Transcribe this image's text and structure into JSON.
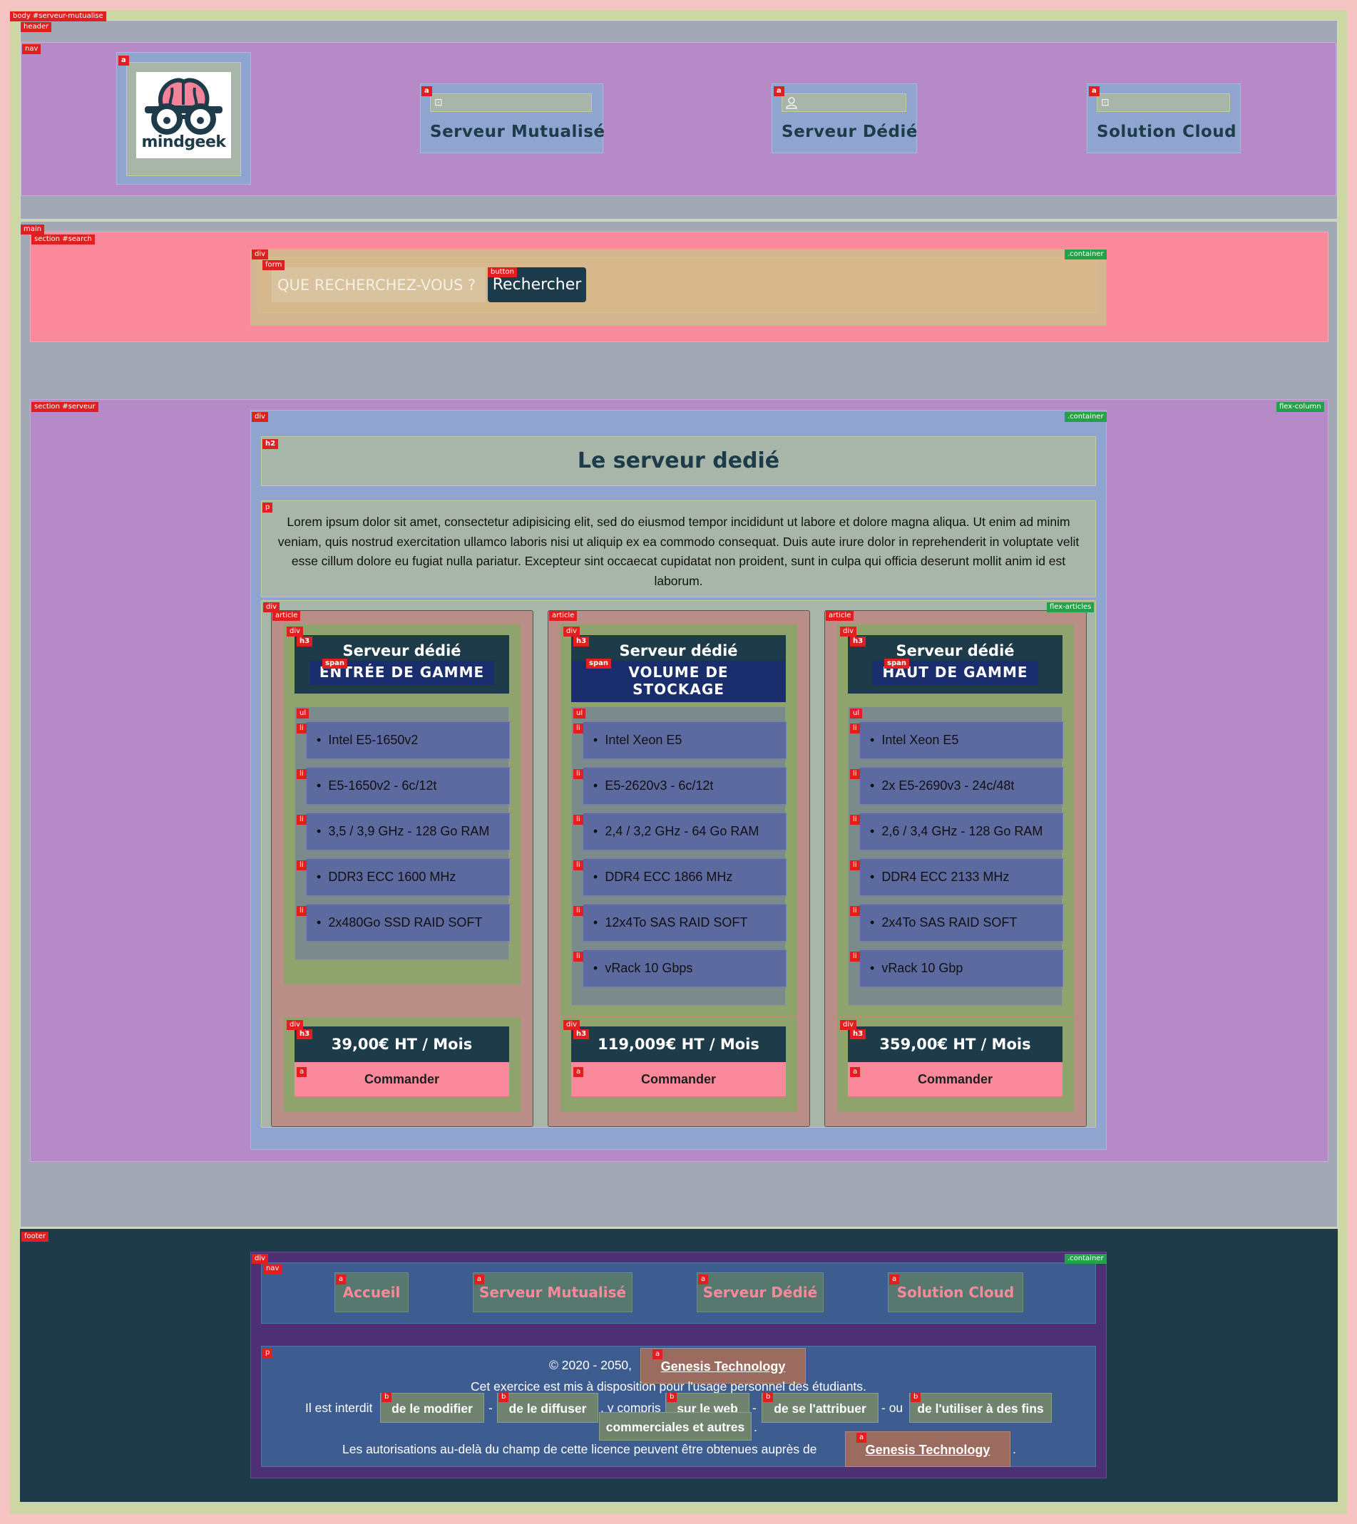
{
  "brand": {
    "logo_text": "mindgeek"
  },
  "header": {
    "nav": [
      {
        "label": "Serveur Mutualisé",
        "icon": "server-icon"
      },
      {
        "label": "Serveur Dédié",
        "icon": "user-icon"
      },
      {
        "label": "Solution Cloud",
        "icon": "cloud-icon"
      }
    ]
  },
  "search": {
    "placeholder": "QUE RECHERCHEZ-VOUS ?",
    "button_label": "Rechercher"
  },
  "serveur": {
    "title": "Le serveur dedié",
    "description": "Lorem ipsum dolor sit amet, consectetur adipisicing elit, sed do eiusmod tempor incididunt ut labore et dolore magna aliqua. Ut enim ad minim veniam, quis nostrud exercitation ullamco laboris nisi ut aliquip ex ea commodo consequat. Duis aute irure dolor in reprehenderit in voluptate velit esse cillum dolore eu fugiat nulla pariatur. Excepteur sint occaecat cupidatat non proident, sunt in culpa qui officia deserunt mollit anim id est laborum.",
    "offers": [
      {
        "title": "Serveur dédié",
        "subtitle": "ENTRÉE DE GAMME",
        "specs": [
          "Intel E5-1650v2",
          "E5-1650v2 - 6c/12t",
          "3,5 / 3,9 GHz - 128 Go RAM",
          "DDR3 ECC 1600 MHz",
          "2x480Go SSD RAID SOFT"
        ],
        "price": "39,00€ HT / Mois",
        "order_label": "Commander"
      },
      {
        "title": "Serveur dédié",
        "subtitle": "VOLUME DE STOCKAGE",
        "specs": [
          "Intel Xeon E5",
          "E5-2620v3 - 6c/12t",
          "2,4 / 3,2 GHz - 64 Go RAM",
          "DDR4 ECC 1866 MHz",
          "12x4To SAS RAID SOFT",
          "vRack 10 Gbps"
        ],
        "price": "119,009€ HT / Mois",
        "order_label": "Commander"
      },
      {
        "title": "Serveur dédié",
        "subtitle": "HAUT DE GAMME",
        "specs": [
          "Intel Xeon E5",
          "2x E5-2690v3 - 24c/48t",
          "2,6 / 3,4 GHz - 128 Go RAM",
          "DDR4 ECC 2133 MHz",
          "2x4To SAS RAID SOFT",
          "vRack 10 Gbp"
        ],
        "price": "359,00€ HT / Mois",
        "order_label": "Commander"
      }
    ]
  },
  "footer": {
    "nav": [
      "Accueil",
      "Serveur Mutualisé",
      "Serveur Dédié",
      "Solution Cloud"
    ],
    "legal": {
      "copyright": "© 2020 - 2050,",
      "company": "Genesis Technology",
      "line2": "Cet exercice est mis à disposition pour l'usage personnel des étudiants.",
      "interdit": "Il est interdit",
      "b1": "de le modifier",
      "sep1": "-",
      "b2": "de le diffuser",
      "compris": ", y compris",
      "b3": "sur le web",
      "sep2": "-",
      "b4": "de se l'attribuer",
      "ou": "- ou",
      "b5a": "de l'utiliser à des fins",
      "b5b": "commerciales et autres",
      "dot": ".",
      "line4": "Les autorisations au-delà du champ de cette licence peuvent être obtenues auprès de",
      "company2": "Genesis Technology",
      "dot2": "."
    }
  },
  "debug_labels": {
    "body": "body #serveur-mutualise",
    "header": "header",
    "nav": "nav",
    "a": "a",
    "main": "main",
    "section_search": "section #search",
    "div": "div",
    "container": ".container",
    "form": "form",
    "button": "button",
    "section_serveur": "section #serveur",
    "flex_column": "flex-column",
    "h2": "h2",
    "p": "p",
    "article": "article",
    "flex_articles": "flex-articles",
    "h3": "h3",
    "span": "span",
    "ul": "ul",
    "li": "li",
    "footer": "footer",
    "b": "b"
  }
}
